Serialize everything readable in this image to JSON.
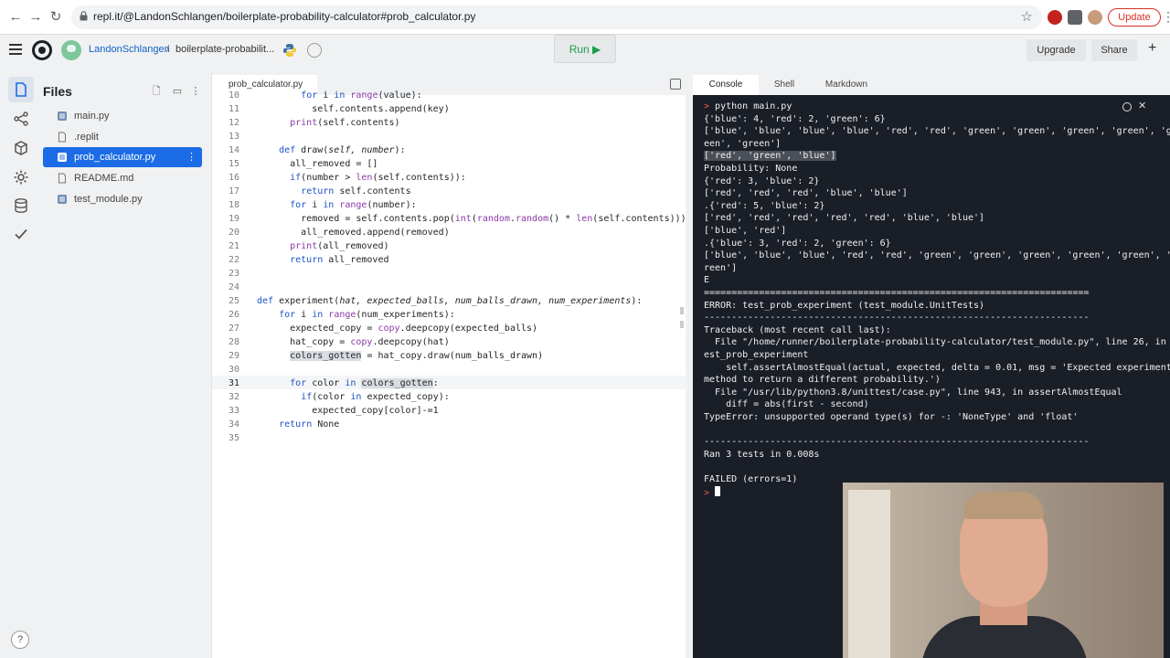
{
  "browser": {
    "url": "repl.it/@LandonSchlangen/boilerplate-probability-calculator#prob_calculator.py",
    "update_label": "Update"
  },
  "topbar": {
    "username": "LandonSchlangen",
    "separator": "/",
    "repl_name": "boilerplate-probabilit...",
    "run_label": "Run ▶",
    "upgrade_label": "Upgrade",
    "share_label": "Share"
  },
  "files": {
    "title": "Files",
    "items": [
      {
        "name": "main.py",
        "icon": "python-file-icon"
      },
      {
        "name": ".replit",
        "icon": "file-icon"
      },
      {
        "name": "prob_calculator.py",
        "icon": "python-file-icon",
        "active": true
      },
      {
        "name": "README.md",
        "icon": "file-icon"
      },
      {
        "name": "test_module.py",
        "icon": "python-file-icon"
      }
    ]
  },
  "editor": {
    "tab_label": "prob_calculator.py",
    "lines": [
      {
        "n": "10",
        "text": "        for i in range(value):"
      },
      {
        "n": "11",
        "text": "          self.contents.append(key)"
      },
      {
        "n": "12",
        "text": "      print(self.contents)"
      },
      {
        "n": "13",
        "text": ""
      },
      {
        "n": "14",
        "text": "    def draw(self, number):"
      },
      {
        "n": "15",
        "text": "      all_removed = []"
      },
      {
        "n": "16",
        "text": "      if(number > len(self.contents)):"
      },
      {
        "n": "17",
        "text": "        return self.contents"
      },
      {
        "n": "18",
        "text": "      for i in range(number):"
      },
      {
        "n": "19",
        "text": "        removed = self.contents.pop(int(random.random() * len(self.contents)))"
      },
      {
        "n": "20",
        "text": "        all_removed.append(removed)"
      },
      {
        "n": "21",
        "text": "      print(all_removed)"
      },
      {
        "n": "22",
        "text": "      return all_removed"
      },
      {
        "n": "23",
        "text": ""
      },
      {
        "n": "24",
        "text": ""
      },
      {
        "n": "25",
        "text": "def experiment(hat, expected_balls, num_balls_drawn, num_experiments):"
      },
      {
        "n": "26",
        "text": "    for i in range(num_experiments):"
      },
      {
        "n": "27",
        "text": "      expected_copy = copy.deepcopy(expected_balls)"
      },
      {
        "n": "28",
        "text": "      hat_copy = copy.deepcopy(hat)"
      },
      {
        "n": "29",
        "text": "      colors_gotten = hat_copy.draw(num_balls_drawn)"
      },
      {
        "n": "30",
        "text": ""
      },
      {
        "n": "31",
        "text": "      for color in colors_gotten:"
      },
      {
        "n": "32",
        "text": "        if(color in expected_copy):"
      },
      {
        "n": "33",
        "text": "          expected_copy[color]-=1"
      },
      {
        "n": "34",
        "text": "    return None"
      },
      {
        "n": "35",
        "text": ""
      }
    ]
  },
  "console": {
    "tabs": [
      "Console",
      "Shell",
      "Markdown"
    ],
    "lines": [
      "> python main.py",
      "{'blue': 4, 'red': 2, 'green': 6}",
      "['blue', 'blue', 'blue', 'blue', 'red', 'red', 'green', 'green', 'green', 'green', 'gr",
      "een', 'green']",
      "['red', 'green', 'blue']",
      "Probability: None",
      "{'red': 3, 'blue': 2}",
      "['red', 'red', 'red', 'blue', 'blue']",
      ".{'red': 5, 'blue': 2}",
      "['red', 'red', 'red', 'red', 'red', 'blue', 'blue']",
      "['blue', 'red']",
      ".{'blue': 3, 'red': 2, 'green': 6}",
      "['blue', 'blue', 'blue', 'red', 'red', 'green', 'green', 'green', 'green', 'green', 'g",
      "reen']",
      "E",
      "======================================================================",
      "ERROR: test_prob_experiment (test_module.UnitTests)",
      "----------------------------------------------------------------------",
      "Traceback (most recent call last):",
      "  File \"/home/runner/boilerplate-probability-calculator/test_module.py\", line 26, in t",
      "est_prob_experiment",
      "    self.assertAlmostEqual(actual, expected, delta = 0.01, msg = 'Expected experiment",
      "method to return a different probability.')",
      "  File \"/usr/lib/python3.8/unittest/case.py\", line 943, in assertAlmostEqual",
      "    diff = abs(first - second)",
      "TypeError: unsupported operand type(s) for -: 'NoneType' and 'float'",
      "",
      "----------------------------------------------------------------------",
      "Ran 3 tests in 0.008s",
      "",
      "FAILED (errors=1)"
    ],
    "prompt": ">"
  },
  "colors": {
    "accent": "#1b6ce6",
    "run_green": "#1e9e4a",
    "console_bg": "#1a1e26",
    "prompt_red": "#f25c54"
  }
}
